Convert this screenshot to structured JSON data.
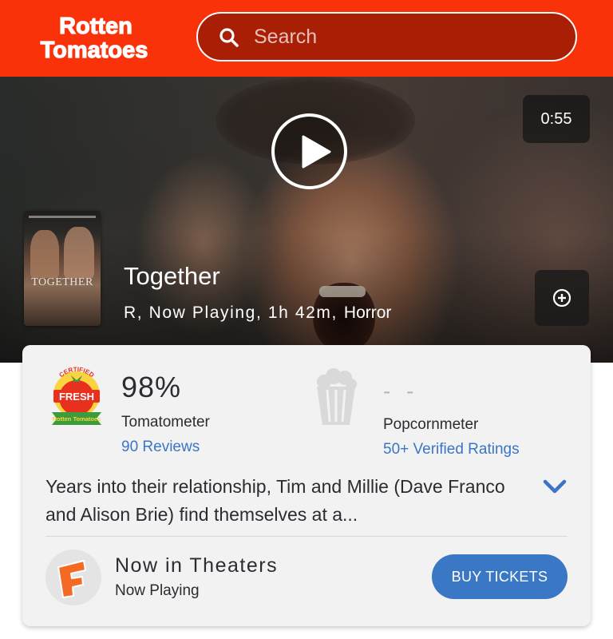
{
  "header": {
    "logo_line1": "Rotten",
    "logo_line2": "Tomatoes",
    "search": {
      "placeholder": "Search",
      "icon": "search-icon"
    },
    "brand_color": "#fa320a"
  },
  "hero": {
    "play_icon": "play-icon",
    "duration": "0:55",
    "poster_title": "TOGETHER",
    "title": "Together",
    "meta": "R, Now Playing, 1h 42m,",
    "genre": "Horror",
    "add_icon": "add-circle-icon"
  },
  "scores": {
    "badge_top": "CERTIFIED",
    "badge_middle": "FRESH",
    "badge_bottom": "Rotten Tomatoes",
    "tomatometer": {
      "value": "98%",
      "label": "Tomatometer",
      "reviews": "90 Reviews"
    },
    "popcornmeter": {
      "value": "- -",
      "label": "Popcornmeter",
      "ratings": "50+ Verified Ratings"
    },
    "link_color": "#3a76c4"
  },
  "synopsis": {
    "text": "Years into their relationship, Tim and Millie (Dave Franco and Alison Brie) find themselves at a...",
    "expand_icon": "chevron-down-icon"
  },
  "theaters": {
    "logo": "fandango-icon",
    "title": "Now in Theaters",
    "subtitle": "Now Playing",
    "button": "BUY TICKETS",
    "button_color": "#3a77c5"
  }
}
